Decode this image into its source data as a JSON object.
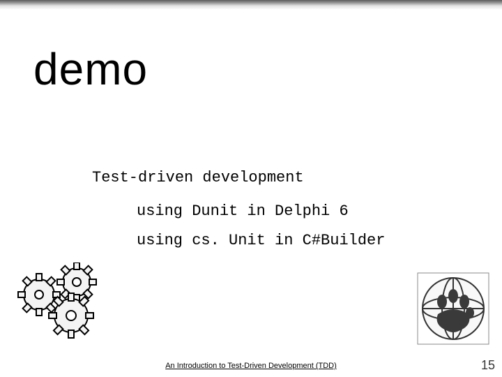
{
  "title": "demo",
  "subtitle": "Test-driven development",
  "bullets": [
    "using Dunit in Delphi 6",
    "using cs. Unit in C#Builder"
  ],
  "footer": "An Introduction to Test-Driven Development (TDD)",
  "page_number": "15",
  "icons": {
    "gears": "gears-icon",
    "globe": "globe-icon"
  }
}
